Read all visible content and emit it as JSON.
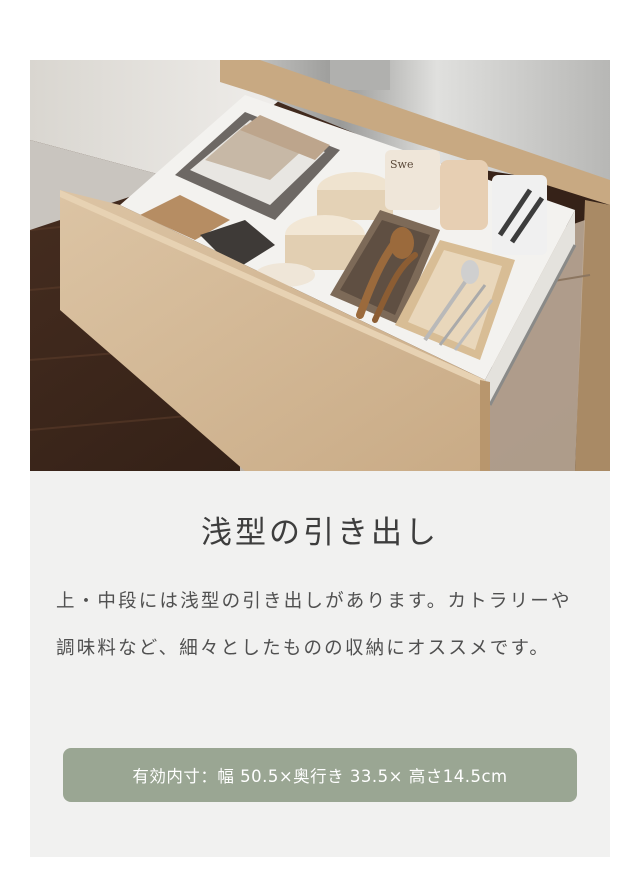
{
  "section": {
    "heading": "浅型の引き出し",
    "description": "上・中段には浅型の引き出しがあります。カトラリーや調味料など、細々としたものの収納にオススメです。",
    "spec_label": "有効内寸：幅 50.5×奥行き 33.5× 高さ14.5cm"
  },
  "photo": {
    "tin_label": "Swe",
    "alt": "drawer-photo"
  },
  "colors": {
    "page_bg": "#ffffff",
    "card_bg": "#f1f1f0",
    "badge_bg": "#9aa693",
    "heading": "#3d3d3d",
    "body_text": "#505050",
    "wood": "#d4b795",
    "floor": "#3b261b"
  }
}
